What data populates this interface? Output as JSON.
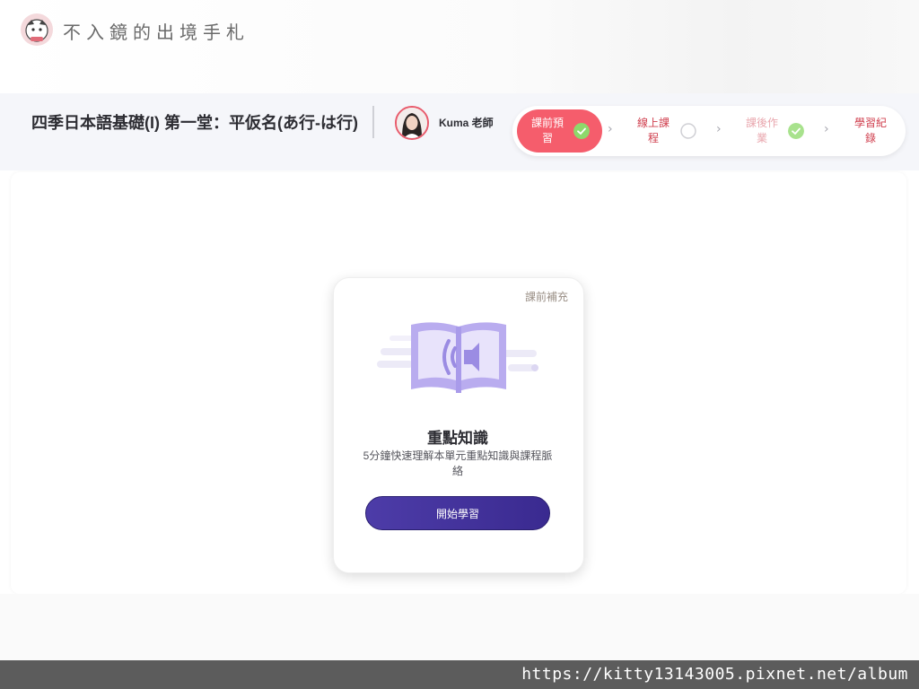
{
  "blog": {
    "title": "不入鏡的出境手札",
    "url": "https://kitty13143005.pixnet.net/album"
  },
  "course": {
    "title": "四季日本語基礎(I) 第一堂：平仮名(あ行-は行)",
    "teacher": "Kuma 老師"
  },
  "steps": [
    {
      "label": "課前預習",
      "state": "active-done"
    },
    {
      "label": "線上課程",
      "state": "pending"
    },
    {
      "label": "課後作業",
      "state": "done"
    },
    {
      "label": "學習紀錄",
      "state": "none"
    }
  ],
  "card": {
    "tag": "課前補充",
    "title": "重點知識",
    "description": "5分鐘快速理解本單元重點知識與課程脈絡",
    "button_label": "開始學習",
    "icon": "audio-book-icon"
  },
  "colors": {
    "accent": "#f55d6c",
    "button": "#3f2f9a",
    "illustration": "#b9acef",
    "check": "#8ed86b"
  }
}
